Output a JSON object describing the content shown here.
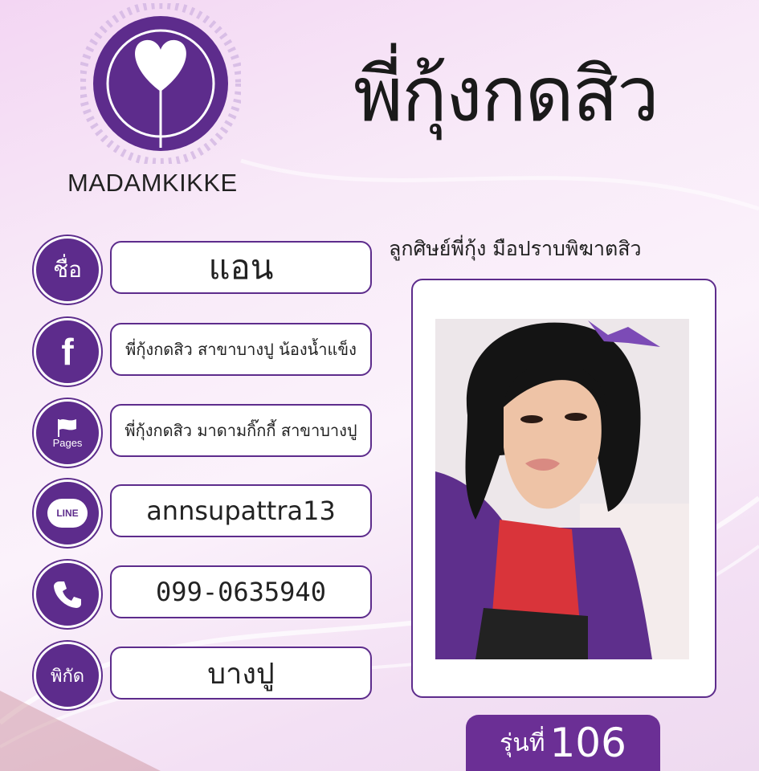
{
  "brand": {
    "name": "MADAMKIKKE"
  },
  "title": "พี่กุ้งกดสิว",
  "subtitle": "ลูกศิษย์พี่กุ้ง มือปราบพิฆาตสิว",
  "rows": [
    {
      "icon_label": "ชื่อ",
      "icon": "name-icon",
      "value": "แอน"
    },
    {
      "icon_label": "f",
      "icon": "facebook-icon",
      "value": "พี่กุ้งกดสิว สาขาบางปู น้องน้ำแข็ง"
    },
    {
      "icon_label": "Pages",
      "icon": "pages-flag-icon",
      "value": "พี่กุ้งกดสิว มาดามกิ๊กกี้ สาขาบางปู"
    },
    {
      "icon_label": "LINE",
      "icon": "line-icon",
      "value": "annsupattra13"
    },
    {
      "icon_label": "",
      "icon": "phone-icon",
      "value": "099-0635940"
    },
    {
      "icon_label": "พิกัด",
      "icon": "location-icon",
      "value": "บางปู"
    }
  ],
  "badge": {
    "label": "รุ่นที่",
    "number": "106"
  },
  "colors": {
    "accent": "#5d2c8c",
    "badge": "#6b2f95",
    "background": "#f8eaf8"
  }
}
